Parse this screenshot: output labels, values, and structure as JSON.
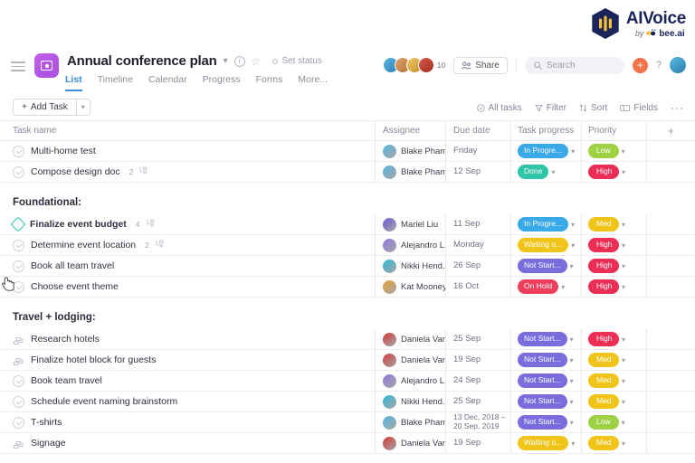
{
  "brand": {
    "title": "AIVoice",
    "by": "by",
    "name": "bee.ai"
  },
  "header": {
    "project_title": "Annual conference plan",
    "set_status": "Set status",
    "tabs": [
      {
        "label": "List",
        "active": true
      },
      {
        "label": "Timeline",
        "active": false
      },
      {
        "label": "Calendar",
        "active": false
      },
      {
        "label": "Progress",
        "active": false
      },
      {
        "label": "Forms",
        "active": false
      },
      {
        "label": "More...",
        "active": false
      }
    ],
    "member_count": "10",
    "share_label": "Share",
    "search_placeholder": "Search",
    "help_label": "?"
  },
  "toolbar": {
    "add_task_label": "Add Task",
    "all_tasks_label": "All tasks",
    "filter_label": "Filter",
    "sort_label": "Sort",
    "fields_label": "Fields",
    "more_label": "···"
  },
  "columns": {
    "task_name": "Task name",
    "assignee": "Assignee",
    "due_date": "Due date",
    "task_progress": "Task progress",
    "priority": "Priority",
    "add_column": "+"
  },
  "colors": {
    "in_progress": "#3aa9e8",
    "done": "#2ec4a6",
    "waiting": "#f0c419",
    "not_started": "#7a6cdd",
    "on_hold": "#ee3e5c",
    "low": "#9fd145",
    "med": "#f0c419",
    "high": "#ec2d55",
    "accent": "#3d8de0",
    "milestone": "#1cc6b0",
    "plus_btn": "#f2724a"
  },
  "rows": [
    {
      "kind": "task",
      "icon": "check-circle-icon",
      "name": "Multi-home test",
      "bold": false,
      "subtasks": "",
      "assignee": "Blake Pham",
      "avatar": "#58b6e0",
      "due": "Friday",
      "progress": "In Progre...",
      "progress_color": "#3aa9e8",
      "priority": "Low",
      "priority_color": "#9fd145"
    },
    {
      "kind": "task",
      "icon": "check-circle-icon",
      "name": "Compose design doc",
      "bold": false,
      "subtasks": "2",
      "assignee": "Blake Pham",
      "avatar": "#58b6e0",
      "due": "12 Sep",
      "progress": "Done",
      "progress_color": "#2ec4a6",
      "priority": "High",
      "priority_color": "#ec2d55"
    },
    {
      "kind": "section",
      "name": "Foundational:"
    },
    {
      "kind": "task",
      "icon": "milestone-diamond-icon",
      "name": "Finalize event budget",
      "bold": true,
      "subtasks": "4",
      "assignee": "Mariel Liu",
      "avatar": "#6f5bd4",
      "due": "11 Sep",
      "progress": "In Progre...",
      "progress_color": "#3aa9e8",
      "priority": "Med",
      "priority_color": "#f0c419"
    },
    {
      "kind": "task",
      "icon": "check-circle-icon",
      "name": "Determine event location",
      "bold": false,
      "subtasks": "2",
      "assignee": "Alejandro L...",
      "avatar": "#8f7ae0",
      "due": "Monday",
      "progress": "Waiting o...",
      "progress_color": "#f0c419",
      "priority": "High",
      "priority_color": "#ec2d55"
    },
    {
      "kind": "task",
      "icon": "check-circle-icon",
      "name": "Book all team travel",
      "bold": false,
      "subtasks": "",
      "assignee": "Nikki Hend...",
      "avatar": "#2fb9d8",
      "due": "26 Sep",
      "progress": "Not Start...",
      "progress_color": "#7a6cdd",
      "priority": "High",
      "priority_color": "#ec2d55"
    },
    {
      "kind": "task",
      "icon": "check-circle-icon",
      "name": "Choose event theme",
      "bold": false,
      "subtasks": "",
      "assignee": "Kat Mooney",
      "avatar": "#e8a33d",
      "due": "16 Oct",
      "progress": "On Hold",
      "progress_color": "#ee3e5c",
      "priority": "High",
      "priority_color": "#ec2d55"
    },
    {
      "kind": "section",
      "name": "Travel + lodging:"
    },
    {
      "kind": "task",
      "icon": "approval-icon",
      "name": "Research hotels",
      "bold": false,
      "subtasks": "",
      "assignee": "Daniela Var...",
      "avatar": "#d23b3b",
      "due": "25 Sep",
      "progress": "Not Start...",
      "progress_color": "#7a6cdd",
      "priority": "High",
      "priority_color": "#ec2d55"
    },
    {
      "kind": "task",
      "icon": "approval-icon",
      "name": "Finalize hotel block for guests",
      "bold": false,
      "subtasks": "",
      "assignee": "Daniela Var...",
      "avatar": "#d23b3b",
      "due": "19 Sep",
      "progress": "Not Start...",
      "progress_color": "#7a6cdd",
      "priority": "Med",
      "priority_color": "#f0c419"
    },
    {
      "kind": "task",
      "icon": "check-circle-icon",
      "name": "Book team travel",
      "bold": false,
      "subtasks": "",
      "assignee": "Alejandro L...",
      "avatar": "#8f7ae0",
      "due": "24 Sep",
      "progress": "Not Start...",
      "progress_color": "#7a6cdd",
      "priority": "Med",
      "priority_color": "#f0c419"
    },
    {
      "kind": "task",
      "icon": "check-circle-icon",
      "name": "Schedule event naming brainstorm",
      "bold": false,
      "subtasks": "",
      "assignee": "Nikki Hend...",
      "avatar": "#2fb9d8",
      "due": "25 Sep",
      "progress": "Not Start...",
      "progress_color": "#7a6cdd",
      "priority": "Med",
      "priority_color": "#f0c419"
    },
    {
      "kind": "task",
      "icon": "check-circle-icon",
      "name": "T-shirts",
      "bold": false,
      "subtasks": "",
      "assignee": "Blake Pham",
      "avatar": "#58b6e0",
      "due": "13 Dec, 2018 –\n20 Sep, 2019",
      "due_two_line": true,
      "progress": "Not Start...",
      "progress_color": "#7a6cdd",
      "priority": "Low",
      "priority_color": "#9fd145"
    },
    {
      "kind": "task",
      "icon": "approval-icon",
      "name": "Signage",
      "bold": false,
      "subtasks": "",
      "assignee": "Daniela Var...",
      "avatar": "#d23b3b",
      "due": "19 Sep",
      "progress": "Waiting o...",
      "progress_color": "#f0c419",
      "priority": "Med",
      "priority_color": "#f0c419"
    }
  ]
}
